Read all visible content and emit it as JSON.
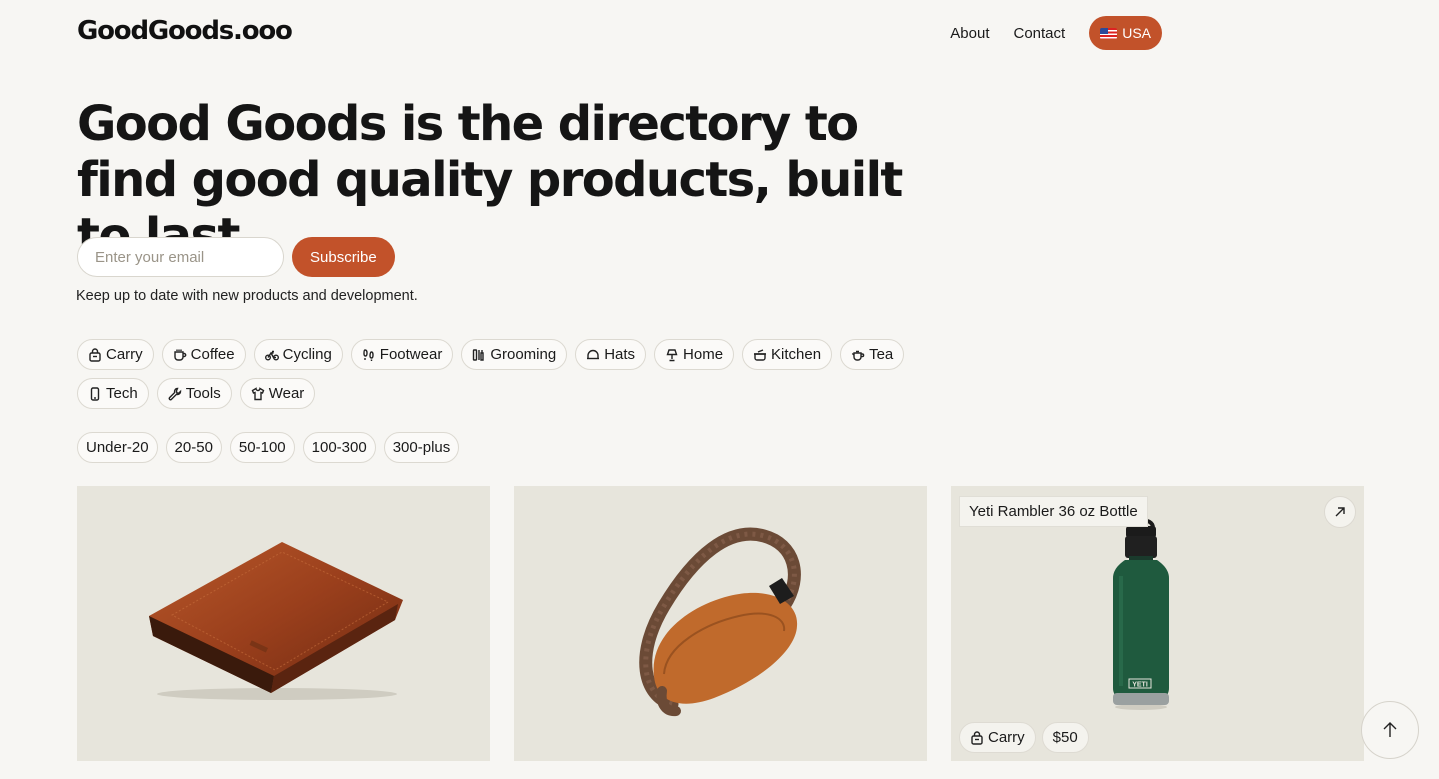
{
  "site": {
    "logo": "GoodGoods.ooo"
  },
  "nav": {
    "about": "About",
    "contact": "Contact",
    "region": "USA"
  },
  "hero": {
    "strong": "Good Goods",
    "rest": " is the directory to find good quality products, built to last."
  },
  "subscribe": {
    "placeholder": "Enter your email",
    "button": "Subscribe",
    "tagline": "Keep up to date with new products and development."
  },
  "categories": [
    {
      "label": "Carry",
      "icon": "bag-icon"
    },
    {
      "label": "Coffee",
      "icon": "cup-icon"
    },
    {
      "label": "Cycling",
      "icon": "bicycle-icon"
    },
    {
      "label": "Footwear",
      "icon": "footprints-icon"
    },
    {
      "label": "Grooming",
      "icon": "razor-icon"
    },
    {
      "label": "Hats",
      "icon": "hat-icon"
    },
    {
      "label": "Home",
      "icon": "lamp-icon"
    },
    {
      "label": "Kitchen",
      "icon": "cooking-pot-icon"
    },
    {
      "label": "Tea",
      "icon": "teapot-icon"
    },
    {
      "label": "Tech",
      "icon": "phone-icon"
    },
    {
      "label": "Tools",
      "icon": "wrench-icon"
    },
    {
      "label": "Wear",
      "icon": "shirt-icon"
    }
  ],
  "prices": [
    "Under-20",
    "20-50",
    "50-100",
    "100-300",
    "300-plus"
  ],
  "products": [
    {
      "image": "brown leather bifold wallet"
    },
    {
      "image": "tan sling bag with brown strap"
    },
    {
      "title": "Yeti Rambler 36 oz Bottle",
      "category": "Carry",
      "price": "$50",
      "image": "green insulated bottle",
      "bottle_brand": "YETI"
    }
  ],
  "colors": {
    "accent": "#c2522a",
    "background": "#f7f6f3",
    "card": "#e7e5dc"
  }
}
